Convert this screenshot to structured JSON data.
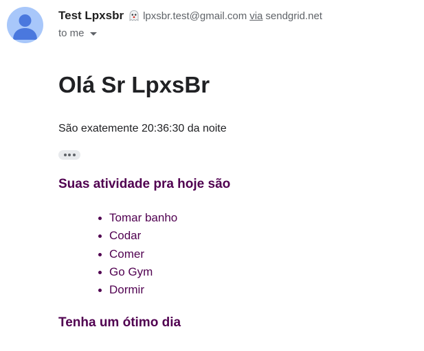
{
  "header": {
    "sender_name": "Test Lpxsbr",
    "sender_email": "lpxsbr.test@gmail.com",
    "via_label": "via",
    "via_domain": "sendgrid.net",
    "recipient_label": "to me",
    "avatar_icon": "person-icon",
    "badge_icon": "ghost-icon",
    "dropdown_icon": "caret-down-icon"
  },
  "body": {
    "greeting": "Olá Sr LpxsBr",
    "time_text": "São exatemente 20:36:30 da noite",
    "trimmed_content_icon": "ellipsis-icon",
    "activities_title": "Suas atividade pra hoje são",
    "activities": [
      "Tomar banho",
      "Codar",
      "Comer",
      "Go Gym",
      "Dormir"
    ],
    "closing": "Tenha um ótimo dia"
  },
  "colors": {
    "accent_purple": "#500050",
    "avatar_bg": "#a8c7fa",
    "avatar_fg": "#4a78de",
    "muted_text": "#5f6368",
    "primary_text": "#202124"
  }
}
